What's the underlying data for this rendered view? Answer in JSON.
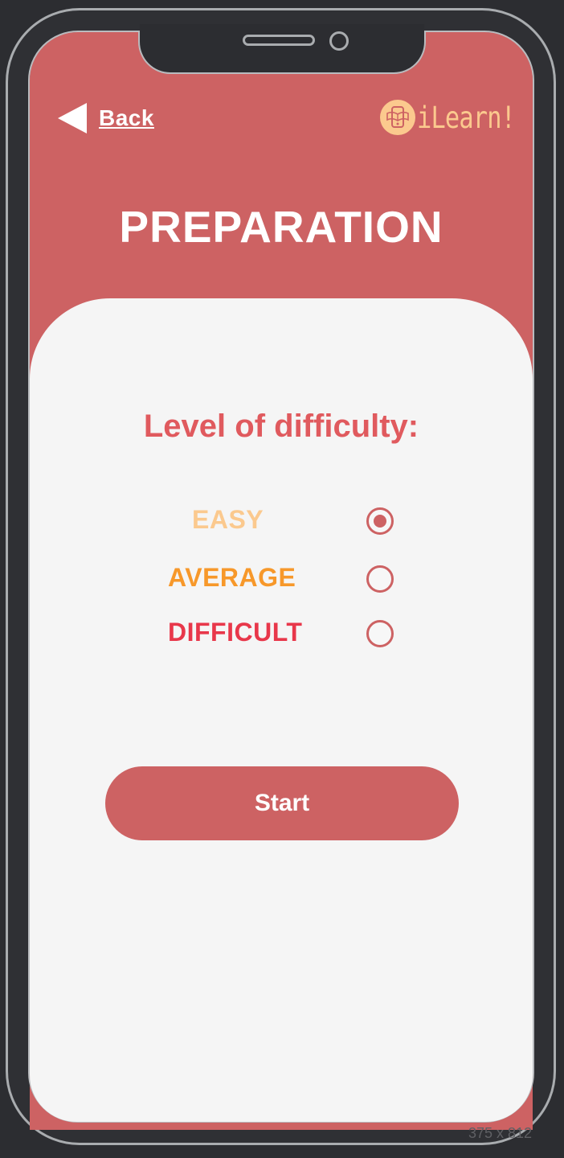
{
  "header": {
    "back_label": "Back",
    "logo_text": "iLearn!",
    "logo_icon": "tablet-book-icon"
  },
  "page_title": "PREPARATION",
  "difficulty": {
    "title": "Level of difficulty:",
    "options": [
      {
        "label": "EASY",
        "color": "#fbc98e",
        "selected": true
      },
      {
        "label": "AVERAGE",
        "color": "#f7982a",
        "selected": false
      },
      {
        "label": "DIFFICULT",
        "color": "#e8374a",
        "selected": false
      }
    ]
  },
  "start_button_label": "Start",
  "device_size_label": "375 x 812",
  "colors": {
    "accent": "#cd6263",
    "background": "#2c2d31",
    "card": "#f5f5f5"
  }
}
